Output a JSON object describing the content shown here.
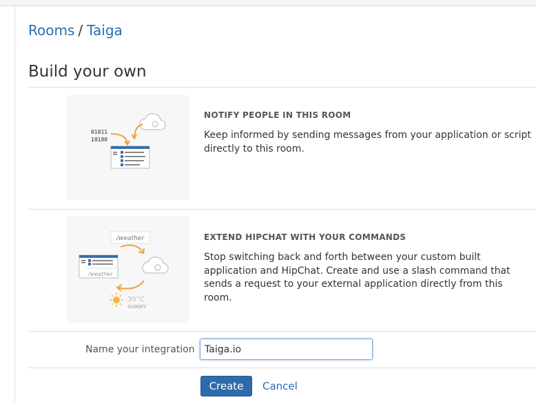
{
  "breadcrumb": {
    "rooms": "Rooms",
    "separator": "/",
    "room": "Taiga"
  },
  "page_title": "Build your own",
  "options": [
    {
      "title": "NOTIFY PEOPLE IN THIS ROOM",
      "description": "Keep informed by sending messages from your application or script directly to this room.",
      "illustration": {
        "binary_line1": "01011",
        "binary_line2": "10100"
      }
    },
    {
      "title": "EXTEND HIPCHAT WITH YOUR COMMANDS",
      "description": "Stop switching back and forth between your custom built application and HipChat. Create and use a slash command that sends a request to your external application directly from this room.",
      "illustration": {
        "command": "/weather",
        "command_echo": "/weather",
        "temperature": "30°C",
        "condition": "SUNNY"
      }
    }
  ],
  "form": {
    "name_label": "Name your integration",
    "name_value": "Taiga.io"
  },
  "actions": {
    "create_label": "Create",
    "cancel_label": "Cancel"
  },
  "colors": {
    "link": "#2a6db0",
    "primary_button": "#2f6bab",
    "accent_orange": "#f0a040"
  }
}
